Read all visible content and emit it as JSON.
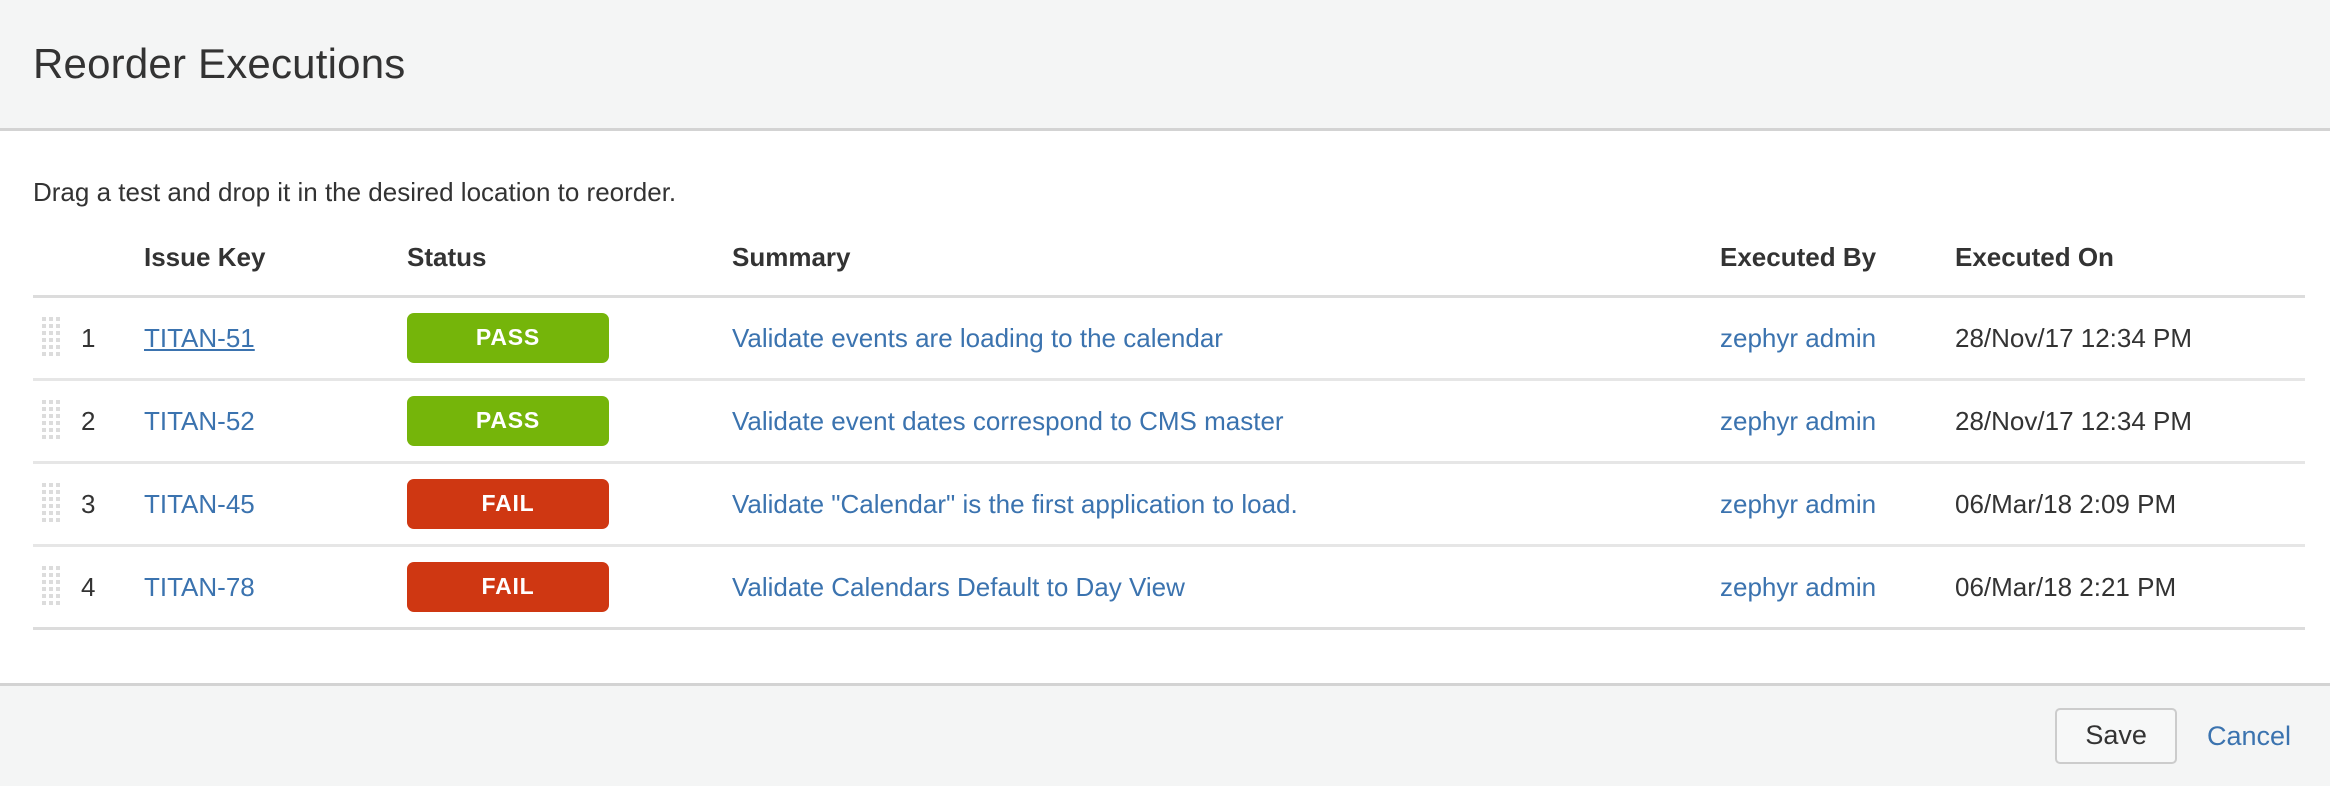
{
  "header": {
    "title": "Reorder Executions"
  },
  "body": {
    "instructions": "Drag a test and drop it in the desired location to reorder."
  },
  "table": {
    "columns": {
      "handle": "",
      "index": "",
      "issue_key": "Issue Key",
      "status": "Status",
      "summary": "Summary",
      "executed_by": "Executed By",
      "executed_on": "Executed On"
    },
    "rows": [
      {
        "index": "1",
        "issue_key": "TITAN-51",
        "status": "PASS",
        "status_type": "pass",
        "summary": "Validate events are loading to the calendar",
        "executed_by": "zephyr admin",
        "executed_on": "28/Nov/17 12:34 PM",
        "handle_icon": "drag-handle-icon"
      },
      {
        "index": "2",
        "issue_key": "TITAN-52",
        "status": "PASS",
        "status_type": "pass",
        "summary": "Validate event dates correspond to CMS master",
        "executed_by": "zephyr admin",
        "executed_on": "28/Nov/17 12:34 PM",
        "handle_icon": "drag-handle-icon"
      },
      {
        "index": "3",
        "issue_key": "TITAN-45",
        "status": "FAIL",
        "status_type": "fail",
        "summary": "Validate \"Calendar\" is the first application to load.",
        "executed_by": "zephyr admin",
        "executed_on": "06/Mar/18 2:09 PM",
        "handle_icon": "drag-handle-icon"
      },
      {
        "index": "4",
        "issue_key": "TITAN-78",
        "status": "FAIL",
        "status_type": "fail",
        "summary": "Validate Calendars Default to Day View",
        "executed_by": "zephyr admin",
        "executed_on": "06/Mar/18 2:21 PM",
        "handle_icon": "drag-handle-icon"
      }
    ]
  },
  "footer": {
    "save_label": "Save",
    "cancel_label": "Cancel"
  },
  "colors": {
    "pass_badge": "#75b50a",
    "fail_badge": "#cf3712",
    "link": "#3b73af",
    "header_band": "#f4f5f5",
    "text": "#333333"
  }
}
